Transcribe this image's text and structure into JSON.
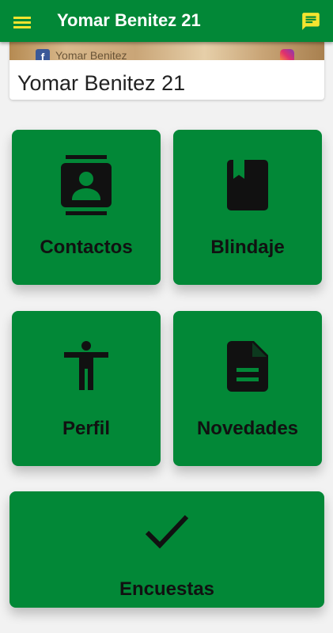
{
  "appbar": {
    "title": "Yomar Benitez 21",
    "menu_icon": "hamburger-menu-icon",
    "chat_icon": "chat-message-icon",
    "accent": "#028837",
    "icon_color": "#f5e42f"
  },
  "banner": {
    "name": "Yomar Benitez 21",
    "image_text": "Yomar Benitez"
  },
  "tiles": [
    {
      "label": "Contactos",
      "icon": "contacts-icon"
    },
    {
      "label": "Blindaje",
      "icon": "book-icon"
    },
    {
      "label": "Perfil",
      "icon": "accessibility-person-icon"
    },
    {
      "label": "Novedades",
      "icon": "document-icon"
    },
    {
      "label": "Encuestas",
      "icon": "checkmark-icon"
    }
  ]
}
